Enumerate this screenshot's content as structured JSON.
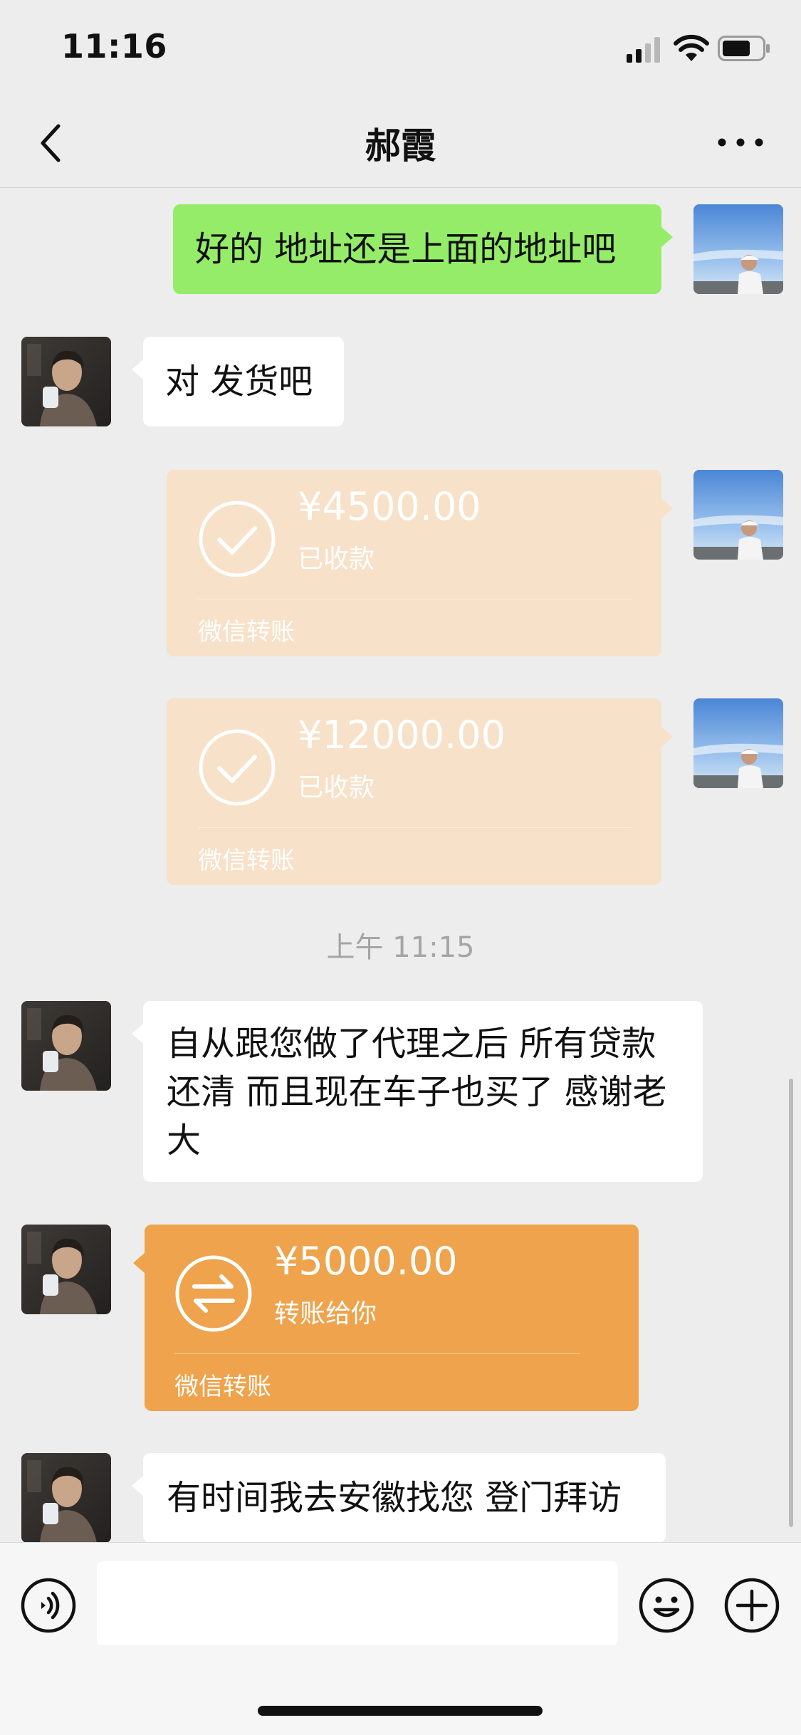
{
  "status_bar": {
    "time": "11:16",
    "icons": [
      "signal-icon",
      "wifi-icon",
      "battery-icon"
    ]
  },
  "nav": {
    "title": "郝霞",
    "back_icon": "chevron-left-icon",
    "more_icon": "more-dots-icon"
  },
  "messages": [
    {
      "sender": "me",
      "type": "text",
      "text": "好的 地址还是上面的地址吧"
    },
    {
      "sender": "friend",
      "type": "text",
      "text": "对 发货吧"
    },
    {
      "sender": "me",
      "type": "transfer",
      "amount": "¥4500.00",
      "status": "已收款",
      "label": "微信转账"
    },
    {
      "sender": "me",
      "type": "transfer",
      "amount": "¥12000.00",
      "status": "已收款",
      "label": "微信转账"
    },
    {
      "sender": "system",
      "type": "time",
      "text": "上午 11:15"
    },
    {
      "sender": "friend",
      "type": "text",
      "text": "自从跟您做了代理之后 所有贷款还清 而且现在车子也买了 感谢老大"
    },
    {
      "sender": "friend",
      "type": "transfer",
      "amount": "¥5000.00",
      "status": "转账给你",
      "label": "微信转账"
    },
    {
      "sender": "friend",
      "type": "text",
      "text": "有时间我去安徽找您 登门拜访"
    }
  ],
  "input_bar": {
    "value": "",
    "icons": [
      "voice-icon",
      "emoji-icon",
      "plus-icon"
    ]
  },
  "colors": {
    "background": "#ededed",
    "my_bubble": "#95ec69",
    "friend_bubble": "#ffffff",
    "transfer_received": "#f7e1c8",
    "transfer_pending": "#eea34c"
  }
}
